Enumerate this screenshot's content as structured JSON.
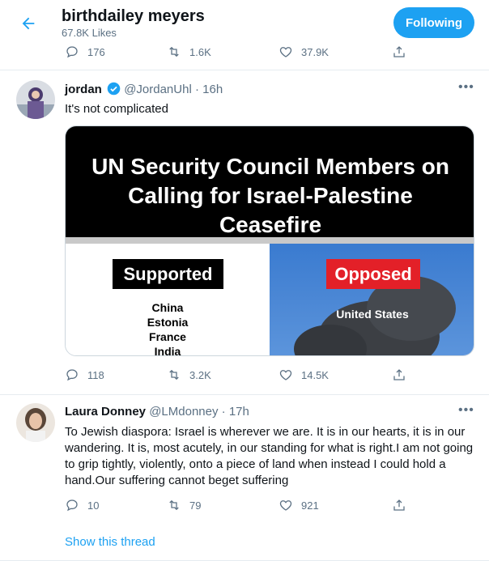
{
  "header": {
    "name": "birthdailey meyers",
    "likes": "67.8K Likes",
    "follow_label": "Following"
  },
  "prev_tweet": {
    "replies": "176",
    "retweets": "1.6K",
    "likes": "37.9K"
  },
  "tweet1": {
    "name": "jordan",
    "verified": true,
    "handle": "@JordanUhl",
    "sep": "·",
    "time": "16h",
    "text": "It's not complicated",
    "card": {
      "title": "UN Security Council Members on Calling for Israel-Palestine Ceasefire",
      "supported_label": "Supported",
      "supported": [
        "China",
        "Estonia",
        "France",
        "India"
      ],
      "opposed_label": "Opposed",
      "opposed": [
        "United States"
      ]
    },
    "replies": "118",
    "retweets": "3.2K",
    "likes": "14.5K"
  },
  "tweet2": {
    "name": "Laura Donney",
    "handle": "@LMdonney",
    "sep": "·",
    "time": "17h",
    "text": "To Jewish diaspora: Israel is wherever we are. It is in our hearts, it is in our wandering. It is, most acutely, in our standing for what is right.I am not going to grip tightly, violently, onto a piece of land when instead I could hold a hand.Our suffering cannot beget suffering",
    "replies": "10",
    "retweets": "79",
    "likes": "921"
  },
  "show_thread": "Show this thread",
  "colors": {
    "accent": "#1da1f2",
    "muted": "#5b7083",
    "opposed": "#e32028"
  },
  "icons": [
    "back-arrow-icon",
    "reply-icon",
    "retweet-icon",
    "like-icon",
    "share-icon",
    "more-icon",
    "verified-badge-icon"
  ]
}
